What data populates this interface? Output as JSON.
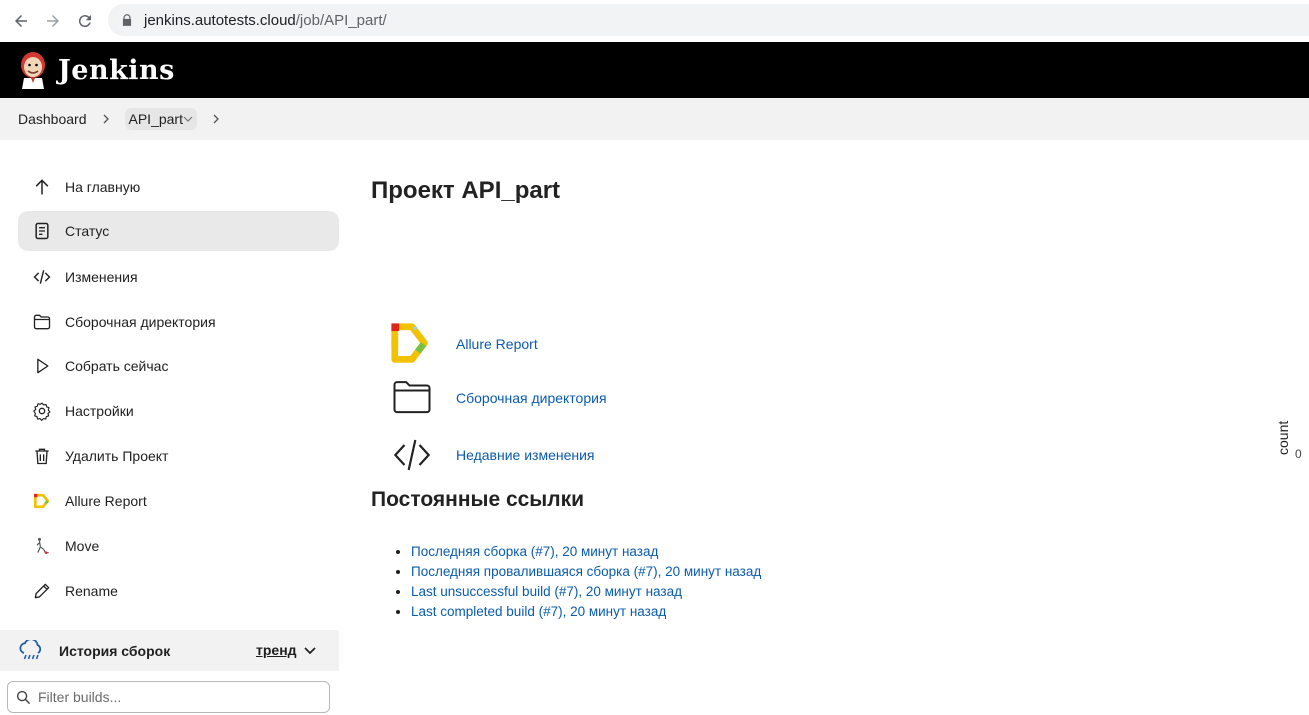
{
  "browser": {
    "url_host": "jenkins.autotests.cloud",
    "url_path": "/job/API_part/"
  },
  "header": {
    "title": "Jenkins"
  },
  "breadcrumb": {
    "items": [
      "Dashboard",
      "API_part"
    ]
  },
  "sidebar": {
    "items": [
      {
        "label": "На главную",
        "icon": "arrow-up-icon"
      },
      {
        "label": "Статус",
        "icon": "document-icon",
        "active": true
      },
      {
        "label": "Изменения",
        "icon": "code-icon"
      },
      {
        "label": "Сборочная директория",
        "icon": "folder-icon"
      },
      {
        "label": "Собрать сейчас",
        "icon": "play-icon"
      },
      {
        "label": "Настройки",
        "icon": "gear-icon"
      },
      {
        "label": "Удалить Проект",
        "icon": "trash-icon"
      },
      {
        "label": "Allure Report",
        "icon": "allure-icon"
      },
      {
        "label": "Move",
        "icon": "move-icon"
      },
      {
        "label": "Rename",
        "icon": "pencil-icon"
      }
    ],
    "build_history": {
      "title": "История сборок",
      "trend": "тренд"
    },
    "filter": {
      "placeholder": "Filter builds..."
    }
  },
  "main": {
    "title": "Проект API_part",
    "links": [
      {
        "label": "Allure Report",
        "icon": "allure-icon"
      },
      {
        "label": "Сборочная директория",
        "icon": "folder-icon"
      },
      {
        "label": "Недавние изменения",
        "icon": "code-icon"
      }
    ],
    "permalinks_title": "Постоянные ссылки",
    "permalinks": [
      "Последняя сборка (#7), 20 минут назад",
      "Последняя провалившаяся сборка (#7), 20 минут назад",
      "Last unsuccessful build (#7), 20 минут назад",
      "Last completed build (#7), 20 минут назад"
    ]
  },
  "trend_chart": {
    "ylabel": "count",
    "tick": "0"
  },
  "colors": {
    "header_bg": "#000000",
    "link": "#0b5cad",
    "active_item_bg": "#e9e9e9",
    "breadcrumb_bg": "#f2f2f2"
  }
}
